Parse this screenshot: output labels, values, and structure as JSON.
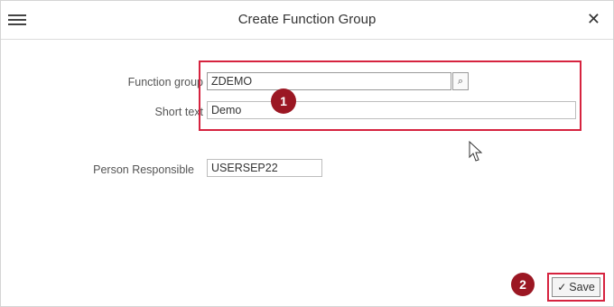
{
  "dialog": {
    "title": "Create Function Group",
    "menu_icon": "hamburger-menu-icon",
    "close_icon": "close-icon",
    "close_symbol": "✕"
  },
  "form": {
    "function_group": {
      "label": "Function group",
      "value": "ZDEMO"
    },
    "short_text": {
      "label": "Short text",
      "value": "Demo"
    },
    "person_responsible": {
      "label": "Person Responsible",
      "value": "USERSEP22"
    },
    "value_help_icon": "value-help-icon",
    "value_help_symbol": "⌕"
  },
  "annotations": {
    "step1": "1",
    "step2": "2",
    "highlight_color": "#d6233f",
    "badge_color": "#9b1723"
  },
  "footer": {
    "save_label": "Save",
    "save_icon": "checkmark-icon",
    "save_symbol": "✓"
  }
}
